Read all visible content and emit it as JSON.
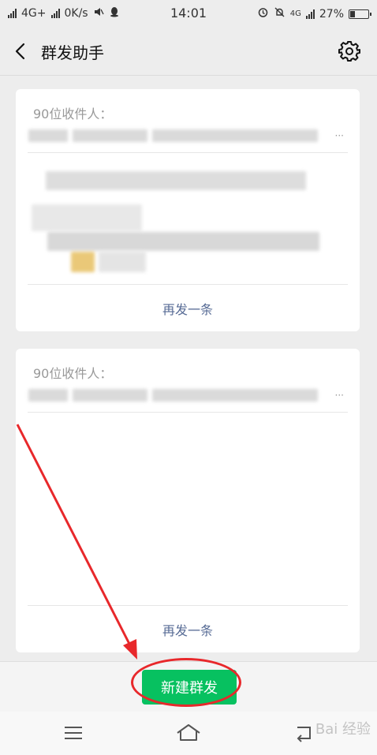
{
  "status_bar": {
    "network": "4G+",
    "speed": "0K/s",
    "time": "14:01",
    "network_right": "4G",
    "battery": "27%",
    "battery_level": 0.27
  },
  "header": {
    "title": "群发助手",
    "back_icon": "chevron-left-icon",
    "settings_icon": "gear-icon"
  },
  "cards": [
    {
      "recipients_label": "90位收件人：",
      "ellipsis": "···",
      "resend_label": "再发一条"
    },
    {
      "recipients_label": "90位收件人：",
      "ellipsis": "···",
      "resend_label": "再发一条"
    }
  ],
  "new_broadcast_button": "新建群发",
  "nav": {
    "menu_icon": "menu-icon",
    "home_icon": "home-icon",
    "back_icon": "back-icon"
  },
  "colors": {
    "accent": "#07c160",
    "link": "#576b95",
    "annotation": "#e8282b"
  },
  "watermark": "Bai 经验"
}
